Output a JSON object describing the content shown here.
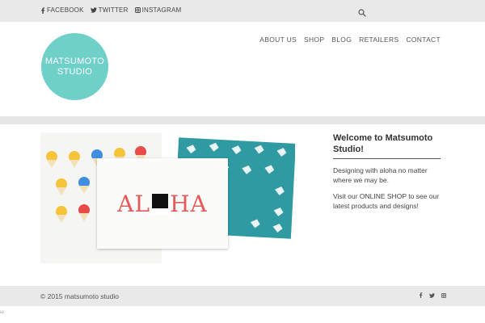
{
  "topbar": {
    "social": [
      {
        "icon": "facebook-icon",
        "label": "FACEBOOK"
      },
      {
        "icon": "twitter-icon",
        "label": "TWITTER"
      },
      {
        "icon": "instagram-icon",
        "label": "INSTAGRAM"
      }
    ],
    "search_icon": "search-icon"
  },
  "header": {
    "logo_line1": "MATSUMOTO",
    "logo_line2": "STUDIO",
    "logo_color": "#6fd0c9",
    "nav": [
      "ABOUT US",
      "SHOP",
      "BLOG",
      "RETAILERS",
      "CONTACT"
    ]
  },
  "main": {
    "image_text": "ALOHA",
    "welcome_title": "Welcome to Matsumoto Studio!",
    "paragraph1": "Designing with aloha no matter where we may be.",
    "paragraph2_before": "Visit our ",
    "paragraph2_link": "ONLINE SHOP",
    "paragraph2_after": " to see our latest products and designs!"
  },
  "footer": {
    "copyright": "© 2015 matsumoto studio",
    "social_icons": [
      "facebook-icon",
      "twitter-icon",
      "instagram-icon"
    ]
  },
  "corner_mark": "ω"
}
